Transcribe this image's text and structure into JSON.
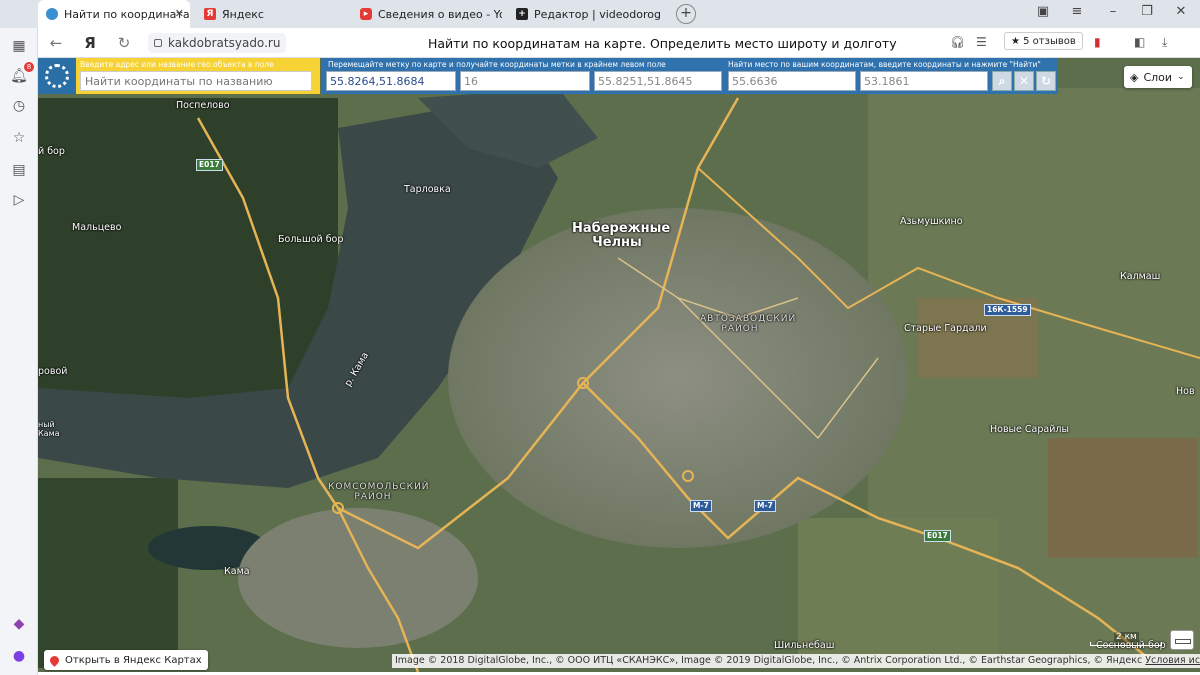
{
  "browser": {
    "tabs": [
      {
        "title": "Найти по координатам на карте",
        "active": true
      },
      {
        "title": "Яндекс"
      },
      {
        "title": "Сведения о видео - YouTube"
      },
      {
        "title": "Редактор | videodorogross"
      }
    ],
    "new_tab": "+",
    "window_controls": {
      "minimize": "–",
      "maximize": "❐",
      "close": "✕"
    },
    "tab_close": "✕"
  },
  "addressbar": {
    "back": "←",
    "yandex": "Я",
    "reload": "↻",
    "url": "kakdobratsyado.ru",
    "page_title": "Найти по координатам на карте. Определить место широту и долготу",
    "reviews": "★ 5 отзывов"
  },
  "sidebar": {
    "notification_count": "8"
  },
  "map": {
    "search": {
      "hint": "Введите адрес или название гео.объекта в поле",
      "placeholder": "Найти координаты по названию"
    },
    "panel": {
      "move_caption": "Перемещайте метку по карте и получайте координаты метки в крайнем левом поле",
      "find_caption": "Найти место по вашим координатам, введите координаты и нажмите \"Найти\"",
      "coords": "55.8264,51.8684",
      "zoom": "16",
      "center": "55.8251,51.8645",
      "lat": "55.6636",
      "lon": "53.1861"
    },
    "layers_label": "Слои",
    "open_in_yandex": "Открыть в Яндекс Картах",
    "scale_label": "2 км",
    "copyright": "Image © 2018 DigitalGlobe, Inc., © ООО ИТЦ «СКАНЭКС», Image © 2019 DigitalGlobe, Inc., © Antrix Corporation Ltd., © Earthstar Geographics, © Яндекс",
    "terms": "Условия использования",
    "labels": {
      "pospelovo": "Поспелово",
      "bor": "й бор",
      "tarlovka": "Тарловка",
      "maltsevo": "Мальцево",
      "bolshoy_bor": "Большой бор",
      "city": "Набережные Челны",
      "azmushkino": "Азьмушкино",
      "kalmash": "Калмаш",
      "avtozavod": "АВТОЗАВОДСКИЙ РАЙОН",
      "starye_gardali": "Старые Гардали",
      "river": "р. Кама",
      "borovoy": "ровой",
      "novye_saraly": "Новые Сарайлы",
      "komsomol": "КОМСОМОЛЬСКИЙ РАЙОН",
      "kama": "Кама",
      "nov": "Нов",
      "shilnebash": "Шильнебаш",
      "sosnovy_bor": "Сосновый бор",
      "left_kama": "ный Кама",
      "road_e017_a": "E017",
      "road_e017_b": "E017",
      "road_m7_a": "M-7",
      "road_m7_b": "M-7",
      "road_16k": "16К-1559"
    }
  }
}
